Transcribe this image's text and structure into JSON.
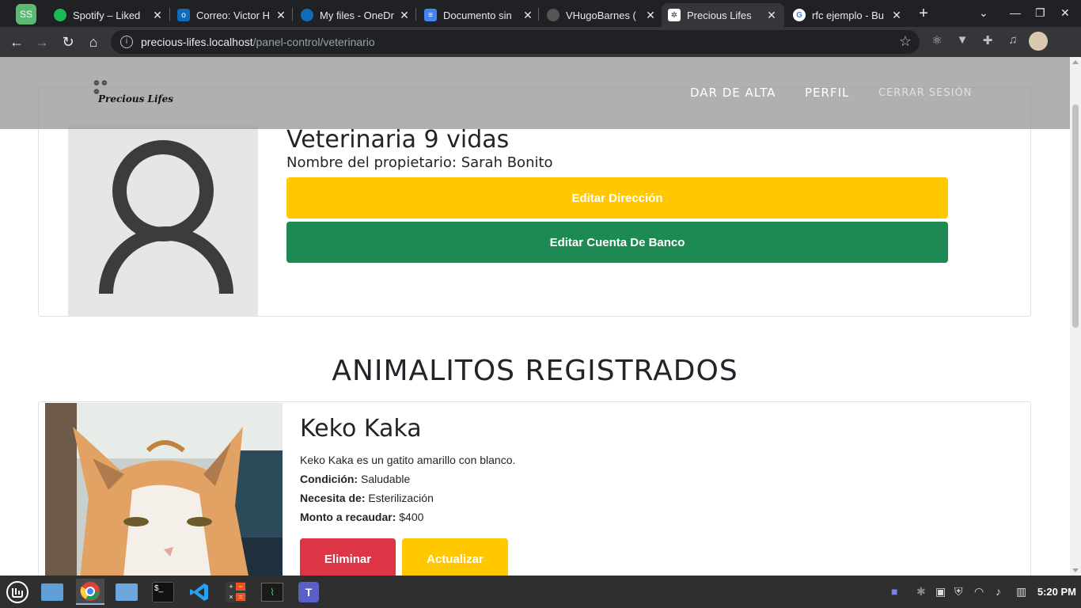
{
  "browser": {
    "profile_initials": "SS",
    "tabs": [
      {
        "label": "Spotify – Liked",
        "icon": "spotify-icon",
        "color": "#1db954"
      },
      {
        "label": "Correo: Victor H",
        "icon": "outlook-icon",
        "color": "#0f6cbd"
      },
      {
        "label": "My files - OneDr",
        "icon": "onedrive-icon",
        "color": "#0f6cbd"
      },
      {
        "label": "Documento sin",
        "icon": "docs-icon",
        "color": "#4285f4"
      },
      {
        "label": "VHugoBarnes (",
        "icon": "github-icon",
        "color": "#555555"
      },
      {
        "label": "Precious Lifes",
        "icon": "paw-icon",
        "color": "#ffffff"
      },
      {
        "label": "rfc ejemplo - Bu",
        "icon": "google-icon",
        "color": "#ffffff"
      }
    ],
    "url_host": "precious-lifes.localhost",
    "url_path": "/panel-control/veterinario"
  },
  "navbar": {
    "logo_text": "Precious Lifes",
    "links": [
      "DAR DE ALTA",
      "PERFIL",
      "CERRAR SESIÓN"
    ]
  },
  "profile": {
    "name": "Veterinaria 9 vidas",
    "owner": "Nombre del propietario: Sarah Bonito",
    "edit_address": "Editar Dirección",
    "edit_bank": "Editar Cuenta De Banco"
  },
  "section_title": "ANIMALITOS REGISTRADOS",
  "animal": {
    "name": "Keko Kaka",
    "description": "Keko Kaka es un gatito amarillo con blanco.",
    "condition_label": "Condición:",
    "condition_value": "Saludable",
    "needs_label": "Necesita de:",
    "needs_value": "Esterilización",
    "amount_label": "Monto a recaudar:",
    "amount_value": "$400",
    "delete_label": "Eliminar",
    "update_label": "Actualizar"
  },
  "taskbar": {
    "clock": "5:20 PM"
  },
  "colors": {
    "yellow": "#ffc800",
    "green": "#1e8a53",
    "red": "#dc3545"
  }
}
